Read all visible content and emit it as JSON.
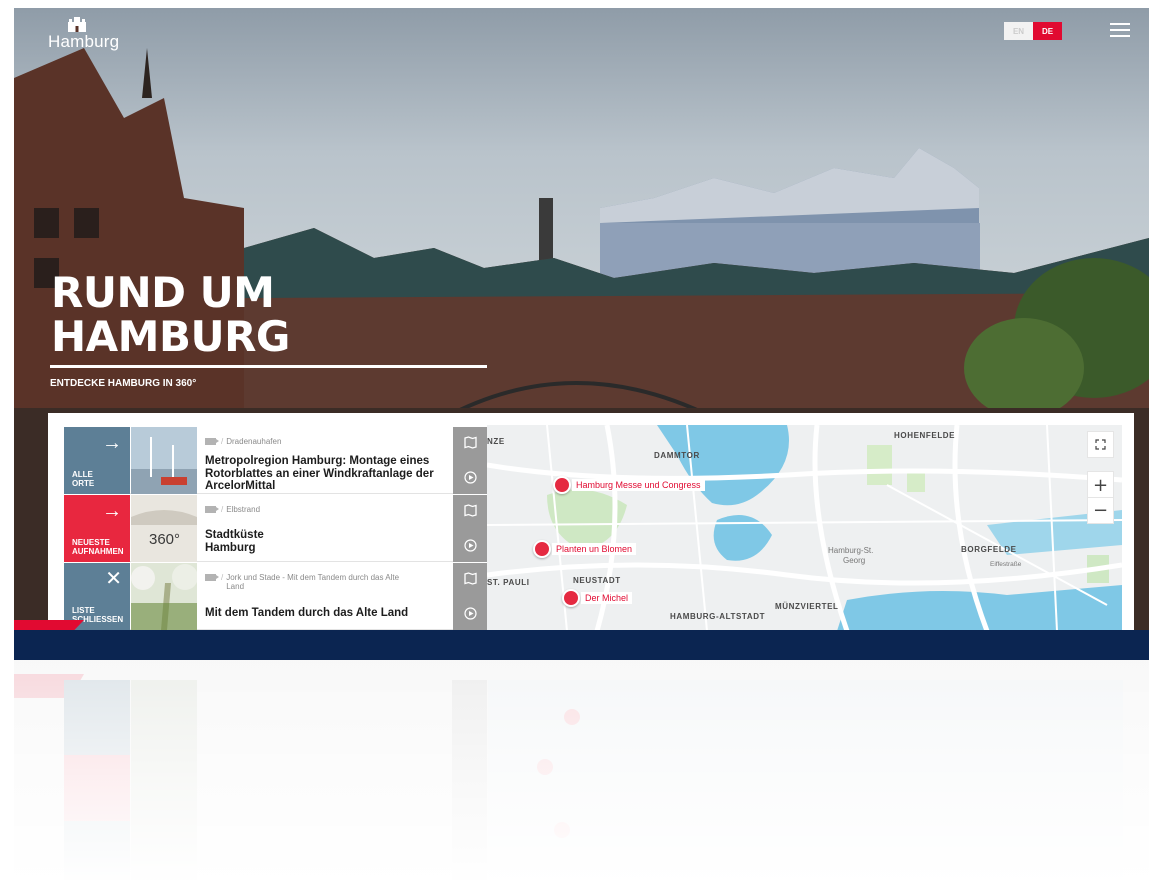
{
  "brand": {
    "name": "Hamburg"
  },
  "language": {
    "en": "EN",
    "de": "DE",
    "active": "DE"
  },
  "hero": {
    "headline_line1": "RUND UM",
    "headline_line2": "HAMBURG",
    "subline": "ENTDECKE HAMBURG IN 360°"
  },
  "list": {
    "items": [
      {
        "tab_label_1": "ALLE",
        "tab_label_2": "ORTE",
        "tab_icon": "→",
        "tab_color": "#5d7f96",
        "location": "Dradenauhafen",
        "title": "Metropolregion Hamburg: Montage eines Rotorblattes an einer Windkraftanlage der ArcelorMittal"
      },
      {
        "tab_label_1": "NEUESTE",
        "tab_label_2": "AUFNAHMEN",
        "tab_icon": "→",
        "tab_color": "#e8273f",
        "location": "Elbstrand",
        "title": "Stadtküste Hamburg",
        "thumb_badge": "360°"
      },
      {
        "tab_label_1": "LISTE",
        "tab_label_2": "SCHLIESSEN",
        "tab_icon": "✕",
        "tab_color": "#5d7f96",
        "location": "Jork und Stade - Mit dem Tandem durch das Alte Land",
        "title": "Mit dem Tandem durch das Alte Land"
      }
    ]
  },
  "map": {
    "districts": [
      "DAMMTOR",
      "HOHENFELDE",
      "NEUSTADT",
      "ST. PAULI",
      "BORGFELDE",
      "MÜNZVIERTEL",
      "HAMBURG-ALTSTADT",
      "NZE"
    ],
    "streets": [
      "Hamburg-St.",
      "Georg",
      "Eiffestraße"
    ],
    "pois": [
      "Hamburg Messe und Congress",
      "Planten un Blomen",
      "Der Michel"
    ],
    "controls": {
      "zoom_in": "+",
      "zoom_out": "−"
    }
  },
  "colors": {
    "brand_red": "#e10a31",
    "navy": "#0b2551",
    "tab_blue": "#5d7f96"
  }
}
